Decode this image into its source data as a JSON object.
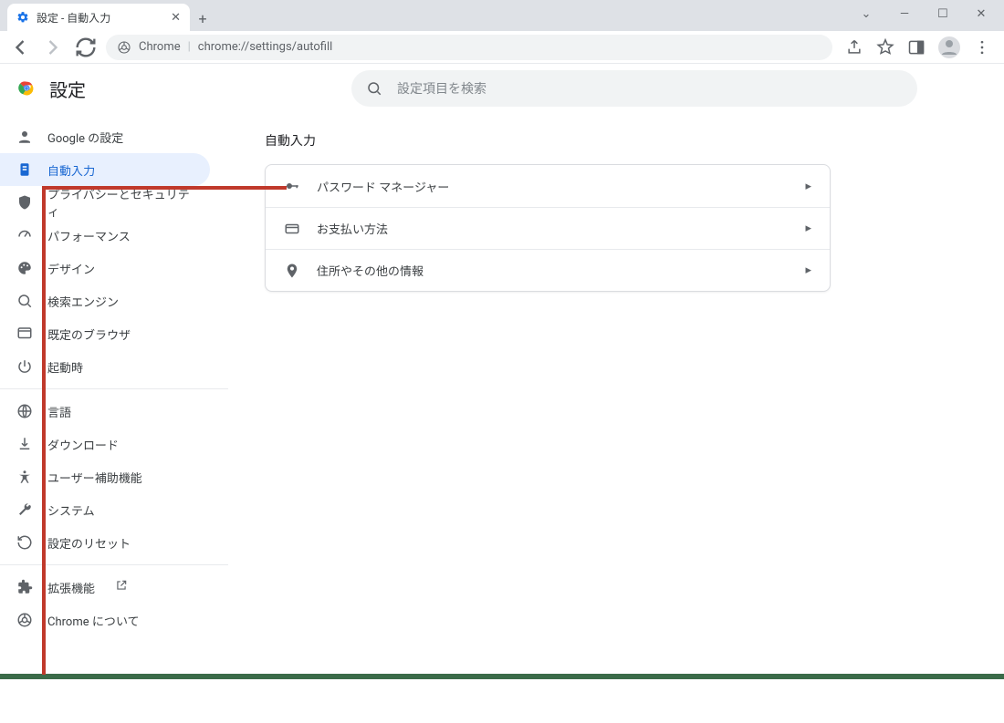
{
  "window": {
    "tab_title": "設定 - 自動入力"
  },
  "toolbar": {
    "chrome_label": "Chrome",
    "url": "chrome://settings/autofill"
  },
  "header": {
    "title": "設定",
    "search_placeholder": "設定項目を検索"
  },
  "sidebar": {
    "groups": [
      {
        "items": [
          {
            "icon": "person",
            "label": "Google の設定"
          },
          {
            "icon": "autofill",
            "label": "自動入力",
            "active": true
          },
          {
            "icon": "shield",
            "label": "プライバシーとセキュリティ"
          },
          {
            "icon": "speed",
            "label": "パフォーマンス"
          },
          {
            "icon": "palette",
            "label": "デザイン"
          },
          {
            "icon": "search",
            "label": "検索エンジン"
          },
          {
            "icon": "browser",
            "label": "既定のブラウザ"
          },
          {
            "icon": "power",
            "label": "起動時"
          }
        ]
      },
      {
        "items": [
          {
            "icon": "globe",
            "label": "言語"
          },
          {
            "icon": "download",
            "label": "ダウンロード"
          },
          {
            "icon": "accessibility",
            "label": "ユーザー補助機能"
          },
          {
            "icon": "wrench",
            "label": "システム"
          },
          {
            "icon": "reset",
            "label": "設定のリセット"
          }
        ]
      },
      {
        "items": [
          {
            "icon": "extension",
            "label": "拡張機能",
            "external": true
          },
          {
            "icon": "chrome",
            "label": "Chrome について"
          }
        ]
      }
    ]
  },
  "main": {
    "section_title": "自動入力",
    "rows": [
      {
        "icon": "key",
        "label": "パスワード マネージャー"
      },
      {
        "icon": "card",
        "label": "お支払い方法"
      },
      {
        "icon": "location",
        "label": "住所やその他の情報"
      }
    ]
  }
}
